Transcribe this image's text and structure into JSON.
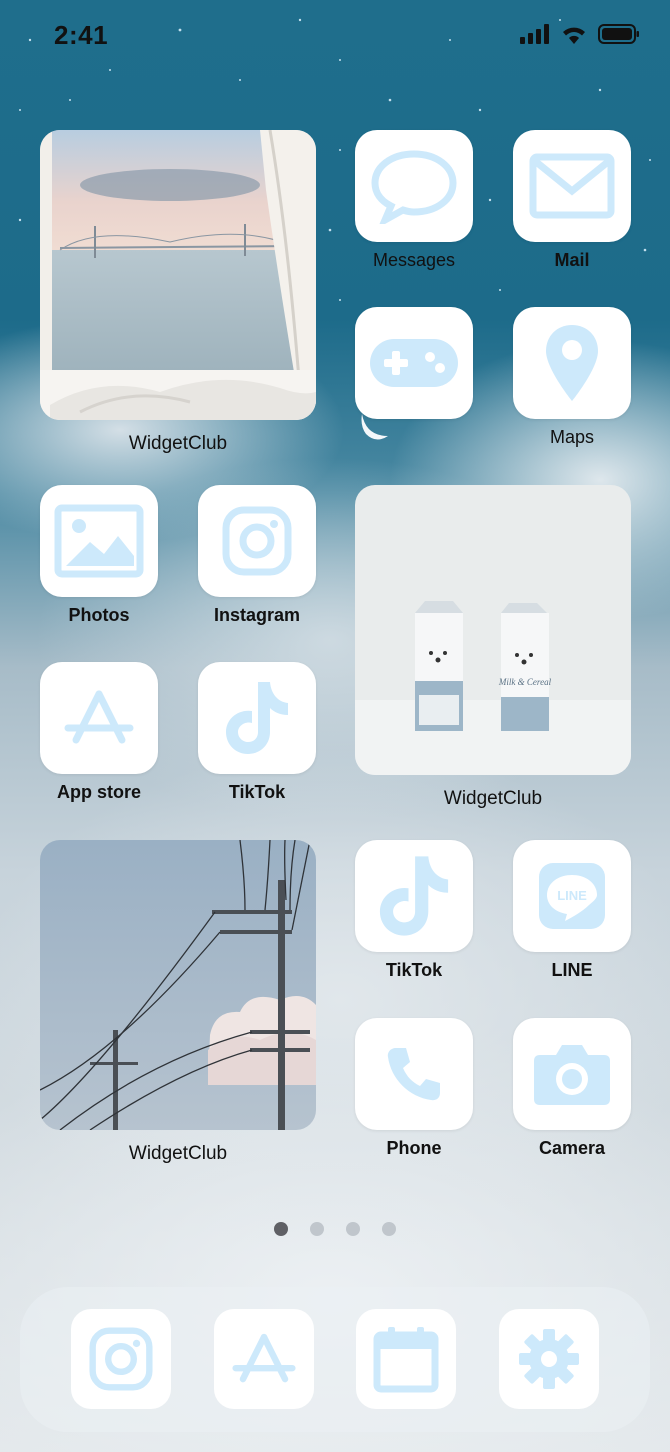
{
  "status_bar": {
    "time": "2:41"
  },
  "apps": {
    "messages": {
      "label": "Messages"
    },
    "mail": {
      "label": "Mail"
    },
    "game": {
      "label": ""
    },
    "maps": {
      "label": "Maps"
    },
    "photos": {
      "label": "Photos"
    },
    "instagram": {
      "label": "Instagram"
    },
    "app_store": {
      "label": "App store"
    },
    "tiktok_1": {
      "label": "TikTok"
    },
    "tiktok_2": {
      "label": "TikTok"
    },
    "line": {
      "label": "LINE",
      "icon_text": "LINE"
    },
    "phone": {
      "label": "Phone"
    },
    "camera": {
      "label": "Camera"
    }
  },
  "widgets": {
    "sea": {
      "label": "WidgetClub"
    },
    "milk": {
      "label": "WidgetClub",
      "carton_text": "Milk & Cereal"
    },
    "wires": {
      "label": "WidgetClub"
    }
  },
  "page_dots": {
    "count": 4,
    "active_index": 0
  },
  "dock": [
    "instagram-icon",
    "app-store-icon",
    "calendar-icon",
    "settings-icon"
  ],
  "colors": {
    "icon_blue": "#cde9fb",
    "tile_white": "#ffffff",
    "sky_teal": "#1f6e8c"
  }
}
